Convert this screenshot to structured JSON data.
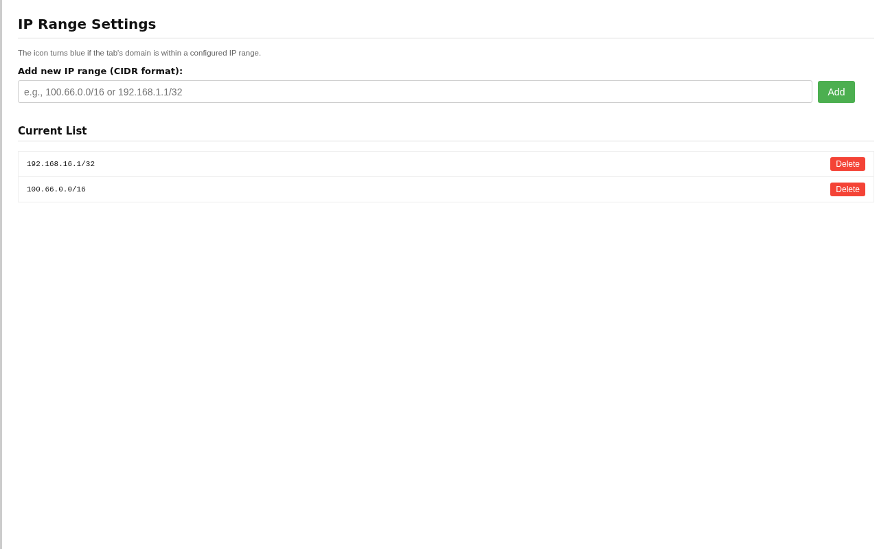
{
  "title": "IP Range Settings",
  "description": "The icon turns blue if the tab's domain is within a configured IP range.",
  "add_form": {
    "label": "Add new IP range (CIDR format):",
    "placeholder": "e.g., 100.66.0.0/16 or 192.168.1.1/32",
    "button": "Add"
  },
  "list": {
    "heading": "Current List",
    "items": [
      {
        "range": "192.168.16.1/32",
        "button": "Delete"
      },
      {
        "range": "100.66.0.0/16",
        "button": "Delete"
      }
    ]
  }
}
